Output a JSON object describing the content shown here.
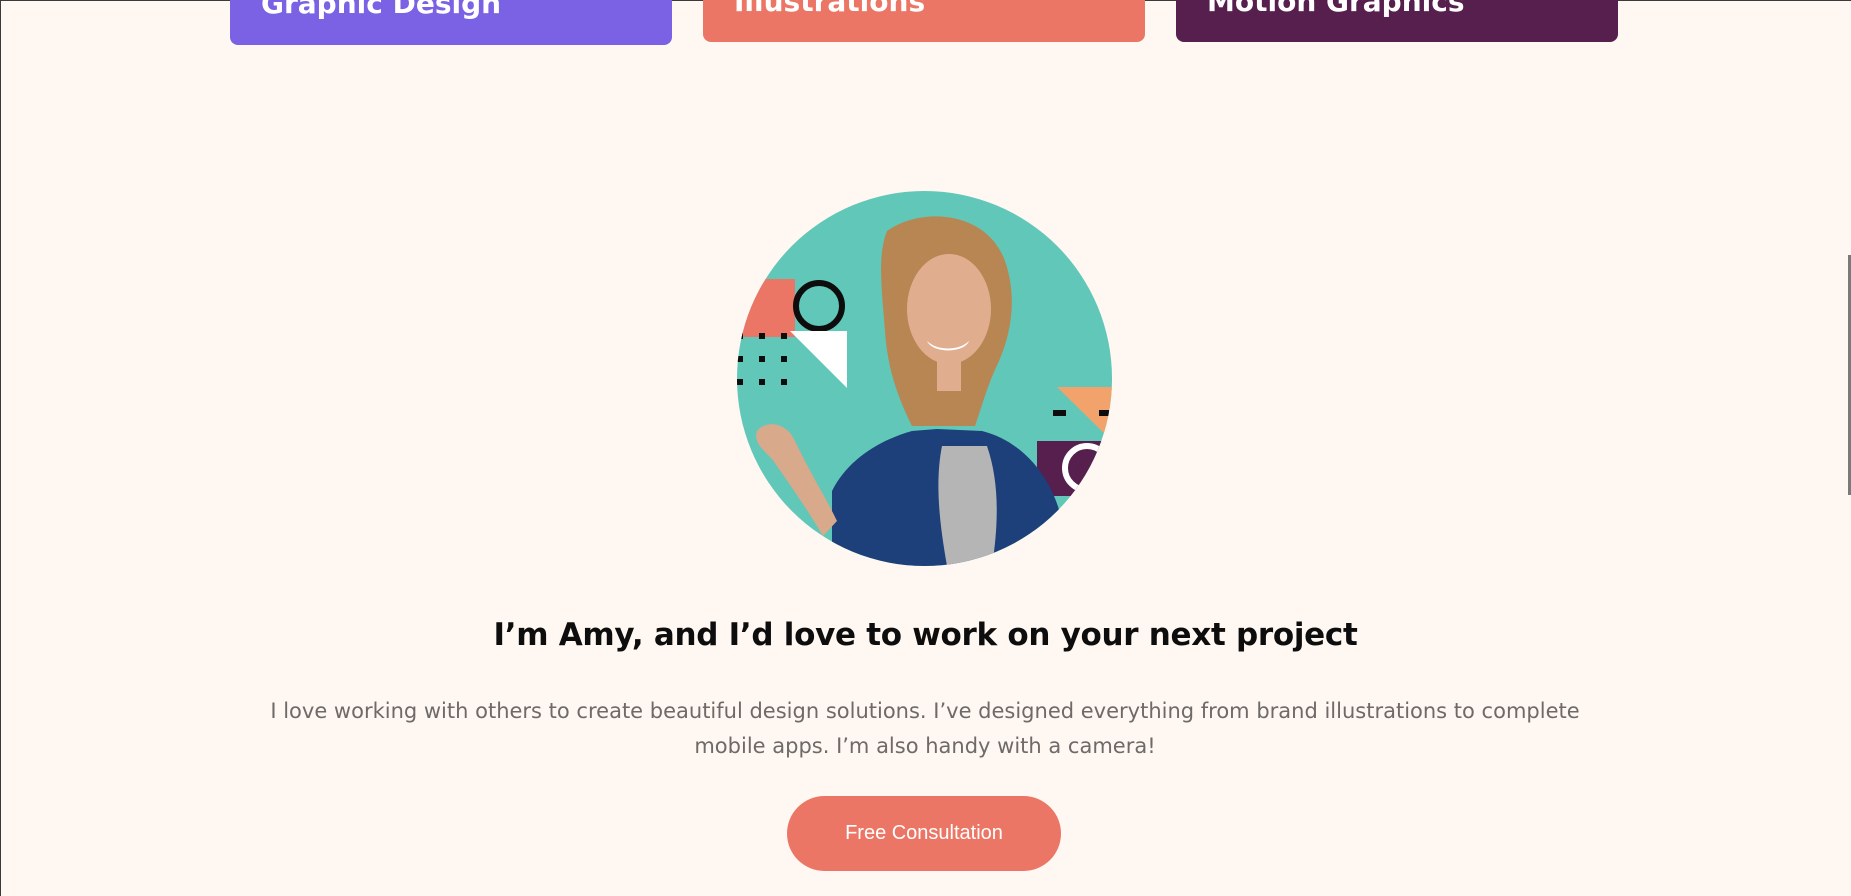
{
  "services": {
    "cards": [
      {
        "label": "Graphic Design",
        "color": "#7b61e4"
      },
      {
        "label": "Illustrations",
        "color": "#ec7665"
      },
      {
        "label": "Motion Graphics",
        "color": "#571f4e"
      }
    ]
  },
  "about": {
    "headline": "I’m Amy, and I’d love to work on your next project",
    "bio": "I love working with others to create beautiful design solutions. I’ve designed everything from brand illustrations to complete mobile apps. I’m also handy with a camera!",
    "cta_label": "Free Consultation",
    "avatar_background": "#61c7b8"
  },
  "colors": {
    "page_background": "#fff7f1",
    "accent": "#ec7665",
    "heading": "#0d0d0d",
    "body_text": "#6d6a68"
  }
}
